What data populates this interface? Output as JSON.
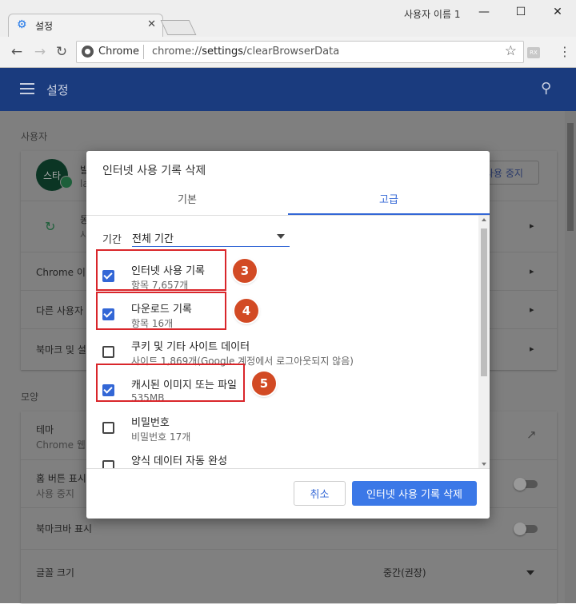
{
  "window": {
    "profile_name": "사용자 이름 1",
    "minimize": "—",
    "maximize": "☐",
    "close": "✕"
  },
  "tab": {
    "title": "설정",
    "close": "✕"
  },
  "toolbar": {
    "back": "←",
    "forward": "→",
    "reload": "↻",
    "site_label": "Chrome",
    "url_scheme": "chrome://",
    "url_path": "settings",
    "url_rest": "/clearBrowserData",
    "star": "☆",
    "extension_label": "RX",
    "menu": "⋮"
  },
  "appbar": {
    "title": "설정",
    "search": "⚲"
  },
  "page": {
    "section_user": "사용자",
    "avatar_text": "스타",
    "name_partial": "발",
    "email_partial": "la",
    "stop_sync_label": "사용 중지",
    "sync_partial": "동",
    "sync_sub_partial": "사",
    "chrome_row": "Chrome 이",
    "other_users_row": "다른 사용자",
    "bookmarks_row": "북마크 및 설",
    "section_appearance": "모양",
    "theme_title": "테마",
    "theme_sub": "Chrome 웹",
    "home_title": "홈 버튼 표시",
    "home_sub": "사용 중지",
    "bookmark_bar": "북마크바 표시",
    "font_size_label": "글꼴 크기",
    "font_size_value": "중간(권장)",
    "chevron": "›"
  },
  "dialog": {
    "title": "인터넷 사용 기록 삭제",
    "tab_basic": "기본",
    "tab_advanced": "고급",
    "period_label": "기간",
    "period_value": "전체 기간",
    "items": [
      {
        "title": "인터넷 사용 기록",
        "sub": "항목 7,657개",
        "checked": true
      },
      {
        "title": "다운로드 기록",
        "sub": "항목 16개",
        "checked": true
      },
      {
        "title": "쿠키 및 기타 사이트 데이터",
        "sub": "사이트 1,869개(Google 계정에서 로그아웃되지 않음)",
        "checked": false
      },
      {
        "title": "캐시된 이미지 또는 파일",
        "sub": "535MB",
        "checked": true
      },
      {
        "title": "비밀번호",
        "sub": "비밀번호 17개",
        "checked": false
      },
      {
        "title": "양식 데이터 자동 완성",
        "sub": "",
        "checked": false
      }
    ],
    "steps": [
      "3",
      "4",
      "5"
    ],
    "cancel_label": "취소",
    "clear_label": "인터넷 사용 기록 삭제"
  },
  "colors": {
    "appbar": "#1a3b7e",
    "accent": "#3367d6",
    "clear_button": "#3b78e7",
    "annotation_red": "#d9262b",
    "step_badge": "#d24a24"
  }
}
